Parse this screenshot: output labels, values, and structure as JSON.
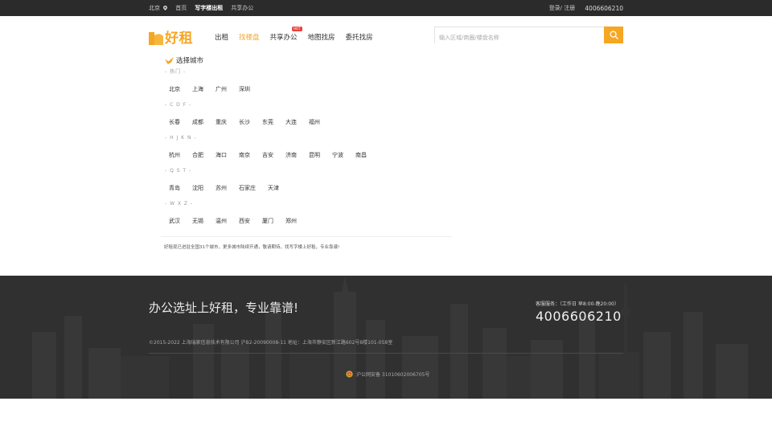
{
  "topbar": {
    "city": "北京",
    "links": [
      {
        "label": "首页",
        "active": false
      },
      {
        "label": "写字楼出租",
        "active": true
      },
      {
        "label": "共享办公",
        "active": false
      }
    ],
    "login_label": "登录/ 注册",
    "phone": "4006606210"
  },
  "header": {
    "logo_text": "好租",
    "nav": [
      {
        "label": "出租",
        "active": false,
        "badge": ""
      },
      {
        "label": "找楼盘",
        "active": true,
        "badge": ""
      },
      {
        "label": "共享办公",
        "active": false,
        "badge": "HOT"
      },
      {
        "label": "地图找房",
        "active": false,
        "badge": ""
      },
      {
        "label": "委托找房",
        "active": false,
        "badge": ""
      }
    ],
    "search_placeholder": "输入区域/商圈/楼盘名称"
  },
  "city_panel": {
    "title": "选择城市",
    "groups": [
      {
        "label": "- 热门 -",
        "cities": [
          "北京",
          "上海",
          "广州",
          "深圳"
        ]
      },
      {
        "label": "- C D F -",
        "cities": [
          "长春",
          "成都",
          "重庆",
          "长沙",
          "东莞",
          "大连",
          "福州"
        ]
      },
      {
        "label": "- H J K N -",
        "cities": [
          "杭州",
          "合肥",
          "海口",
          "南京",
          "吉安",
          "济南",
          "昆明",
          "宁波",
          "南昌"
        ]
      },
      {
        "label": "- Q S T -",
        "cities": [
          "青岛",
          "沈阳",
          "苏州",
          "石家庄",
          "天津"
        ]
      },
      {
        "label": "- W X Z -",
        "cities": [
          "武汉",
          "无锡",
          "温州",
          "西安",
          "厦门",
          "郑州"
        ]
      }
    ],
    "note": "好租现已进驻全国31个城市，更多城市陆续开通，敬请期待，找写字楼上好租，专业靠谱!"
  },
  "footer": {
    "slogan": "办公选址上好租，专业靠谱!",
    "service_label": "客服服务：（工作日 早8:00-晚20:00）",
    "service_phone": "4006606210",
    "copyright": "©2015-2022 上海瑞家信息技术有限公司 沪B2-20090008-11 地址：上海市静安区新江路602号8楼101-058室",
    "police": "沪公网安备 31010602006705号"
  },
  "colors": {
    "accent": "#f5a623",
    "topbar_bg": "#2b2b2b",
    "footer_bg": "#303030",
    "hot_badge": "#e8413c"
  }
}
